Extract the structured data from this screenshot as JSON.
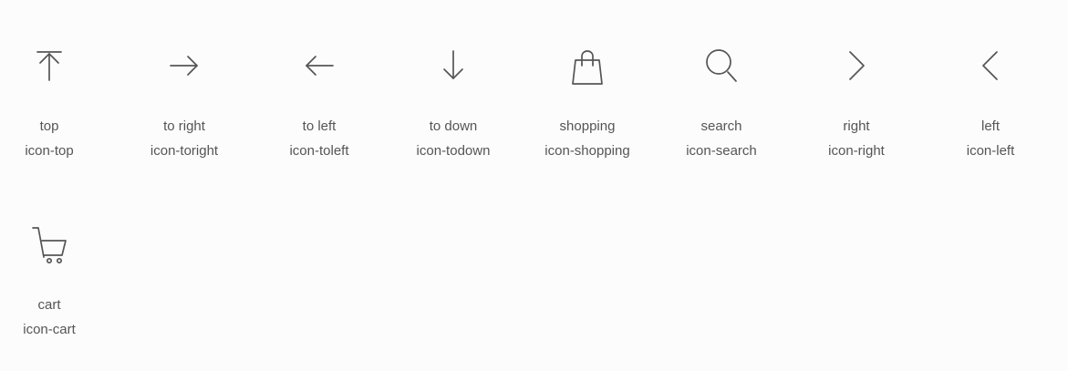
{
  "icons": [
    {
      "icon": "top-icon",
      "title": "top",
      "class_name": "icon-top"
    },
    {
      "icon": "arrow-right-icon",
      "title": "to right",
      "class_name": "icon-toright"
    },
    {
      "icon": "arrow-left-icon",
      "title": "to left",
      "class_name": "icon-toleft"
    },
    {
      "icon": "arrow-down-icon",
      "title": "to down",
      "class_name": "icon-todown"
    },
    {
      "icon": "shopping-bag-icon",
      "title": "shopping",
      "class_name": "icon-shopping"
    },
    {
      "icon": "search-icon",
      "title": "search",
      "class_name": "icon-search"
    },
    {
      "icon": "chevron-right-icon",
      "title": "right",
      "class_name": "icon-right"
    },
    {
      "icon": "chevron-left-icon",
      "title": "left",
      "class_name": "icon-left"
    },
    {
      "icon": "cart-icon",
      "title": "cart",
      "class_name": "icon-cart"
    }
  ],
  "colors": {
    "background": "#fcfcfc",
    "icon_stroke": "#555555",
    "text": "#555555"
  }
}
